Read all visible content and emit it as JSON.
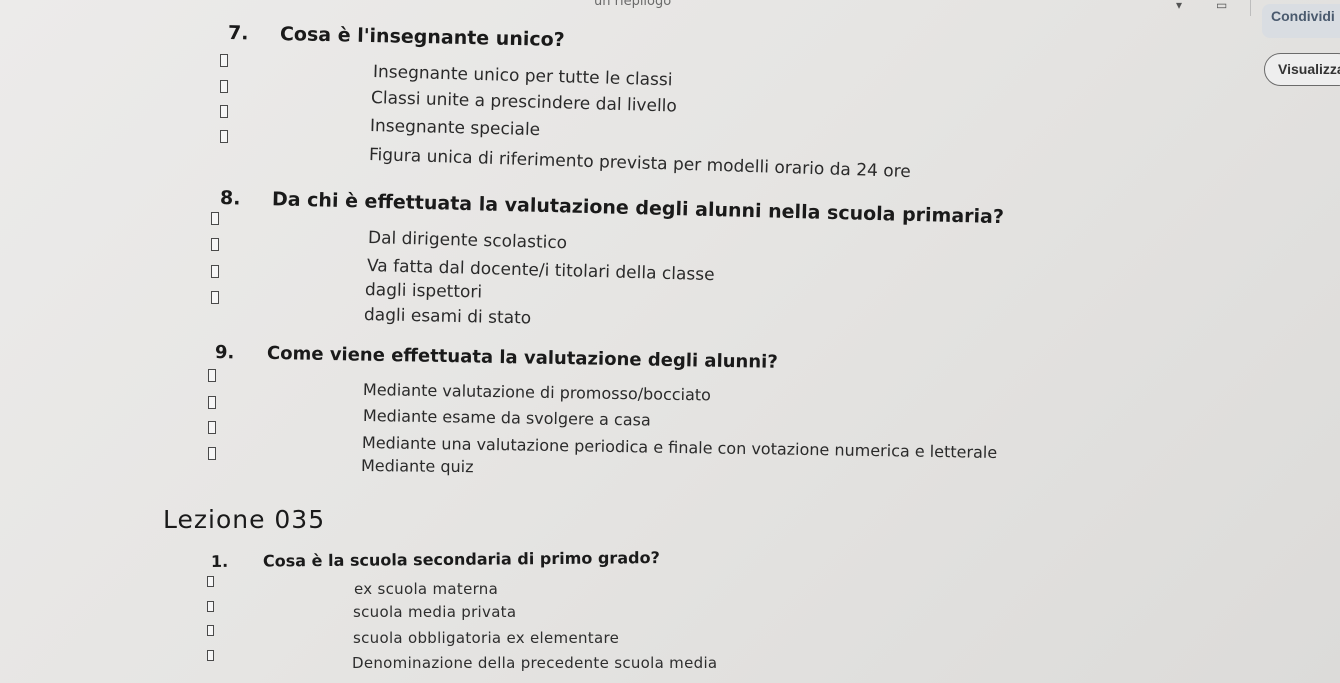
{
  "topbar": {
    "title": "un riepilogo",
    "share_label": "Condividi",
    "view_label": "Visualizza"
  },
  "questions": [
    {
      "number": "7.",
      "text": "Cosa è l'insegnante unico?",
      "options": [
        "Insegnante unico per tutte le classi",
        "Classi unite a prescindere dal livello",
        "Insegnante speciale",
        "Figura unica di riferimento prevista per modelli orario da 24 ore"
      ]
    },
    {
      "number": "8.",
      "text": "Da chi è effettuata la valutazione degli alunni nella scuola primaria?",
      "options": [
        "Dal dirigente scolastico",
        "Va fatta dal docente/i titolari della classe",
        "dagli ispettori",
        "dagli esami di stato"
      ]
    },
    {
      "number": "9.",
      "text": "Come viene effettuata la valutazione degli alunni?",
      "options": [
        "Mediante valutazione di promosso/bocciato",
        "Mediante esame da svolgere a casa",
        "Mediante una valutazione periodica e finale con votazione numerica e letterale",
        "Mediante quiz"
      ]
    }
  ],
  "lesson": {
    "title": "Lezione 035",
    "question": {
      "number": "1.",
      "text": "Cosa è la scuola secondaria di primo grado?",
      "options": [
        "ex scuola materna",
        "scuola media privata",
        "scuola obbligatoria ex elementare",
        "Denominazione della precedente scuola media"
      ]
    }
  }
}
